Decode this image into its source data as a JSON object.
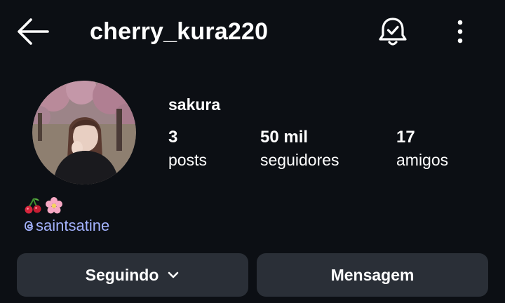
{
  "header": {
    "username": "cherry_kura220",
    "back_icon": "arrow-left-icon",
    "notification_icon": "bell-check-icon",
    "more_icon": "more-vertical-icon"
  },
  "profile": {
    "display_name": "sakura",
    "stats": [
      {
        "value": "3",
        "label": "posts"
      },
      {
        "value": "50 mil",
        "label": "seguidores"
      },
      {
        "value": "17",
        "label": "amigos"
      }
    ],
    "bio": {
      "emojis": [
        "cherries",
        "cherry-blossom"
      ],
      "link_text": "saintsatine",
      "link_icon": "threads-icon"
    }
  },
  "actions": {
    "following_label": "Seguindo",
    "message_label": "Mensagem"
  },
  "colors": {
    "background": "#0c0f14",
    "button": "#2a2f37",
    "link": "#a4b3ff"
  }
}
